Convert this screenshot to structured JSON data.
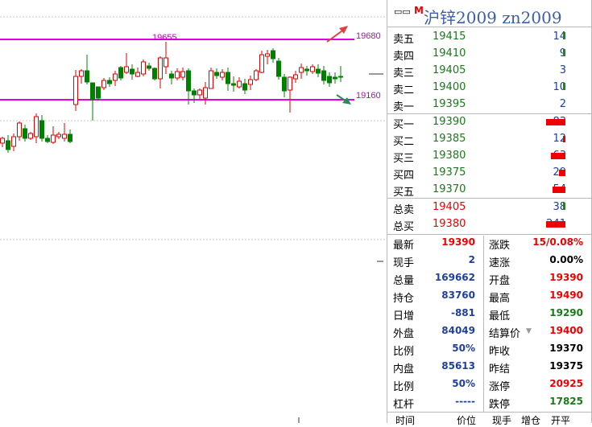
{
  "chart": {
    "level_labels": [
      "19655",
      "19680",
      "19160"
    ],
    "colors": {
      "up": "#e00000",
      "down": "#008000",
      "level_line": "#e000e0",
      "arrow_up": "#e04040",
      "arrow_down": "#2e8b57"
    }
  },
  "header": {
    "icon": "book-icon",
    "flag": "M",
    "title": "沪锌2009  zn2009"
  },
  "order_book": {
    "asks": [
      {
        "label": "卖五",
        "price": "19415",
        "volume": "14",
        "bar": "green"
      },
      {
        "label": "卖四",
        "price": "19410",
        "volume": "9",
        "bar": "green"
      },
      {
        "label": "卖三",
        "price": "19405",
        "volume": "3",
        "bar": "none"
      },
      {
        "label": "卖二",
        "price": "19400",
        "volume": "10",
        "bar": "green"
      },
      {
        "label": "卖一",
        "price": "19395",
        "volume": "2",
        "bar": "none"
      }
    ],
    "bids": [
      {
        "label": "买一",
        "price": "19390",
        "volume": "83",
        "bar": "red"
      },
      {
        "label": "买二",
        "price": "19385",
        "volume": "12",
        "bar": "red"
      },
      {
        "label": "买三",
        "price": "19380",
        "volume": "63",
        "bar": "red"
      },
      {
        "label": "买四",
        "price": "19375",
        "volume": "29",
        "bar": "red"
      },
      {
        "label": "买五",
        "price": "19370",
        "volume": "54",
        "bar": "red"
      }
    ],
    "totals": [
      {
        "label": "总卖",
        "price": "19405",
        "volume": "38",
        "bar": "green"
      },
      {
        "label": "总买",
        "price": "19380",
        "volume": "241",
        "bar": "red"
      }
    ]
  },
  "quote_left": [
    {
      "label": "最新",
      "value": "19390",
      "color": "red"
    },
    {
      "label": "现手",
      "value": "2",
      "color": "blue"
    },
    {
      "label": "总量",
      "value": "169662",
      "color": "blue"
    },
    {
      "label": "持仓",
      "value": "83760",
      "color": "blue"
    },
    {
      "label": "日增",
      "value": "-881",
      "color": "blue"
    },
    {
      "label": "外盘",
      "value": "84049",
      "color": "blue"
    },
    {
      "label": "比例",
      "value": "50%",
      "color": "blue"
    },
    {
      "label": "内盘",
      "value": "85613",
      "color": "blue"
    },
    {
      "label": "比例",
      "value": "50%",
      "color": "blue"
    },
    {
      "label": "杠杆",
      "value": "-----",
      "color": "blue"
    }
  ],
  "quote_right": [
    {
      "label": "涨跌",
      "value": "15/0.08%",
      "color": "red"
    },
    {
      "label": "速涨",
      "value": "0.00%",
      "color": "black"
    },
    {
      "label": "开盘",
      "value": "19390",
      "color": "red"
    },
    {
      "label": "最高",
      "value": "19490",
      "color": "red"
    },
    {
      "label": "最低",
      "value": "19290",
      "color": "green"
    },
    {
      "label": "结算价",
      "value": "19400",
      "color": "red"
    },
    {
      "label": "昨收",
      "value": "19370",
      "color": "black"
    },
    {
      "label": "昨结",
      "value": "19375",
      "color": "black"
    },
    {
      "label": "涨停",
      "value": "20925",
      "color": "red"
    },
    {
      "label": "跌停",
      "value": "17825",
      "color": "green"
    }
  ],
  "footer": {
    "time": "时间",
    "price": "价位",
    "volume": "现手",
    "oi_change": "增仓",
    "open": "开平"
  }
}
